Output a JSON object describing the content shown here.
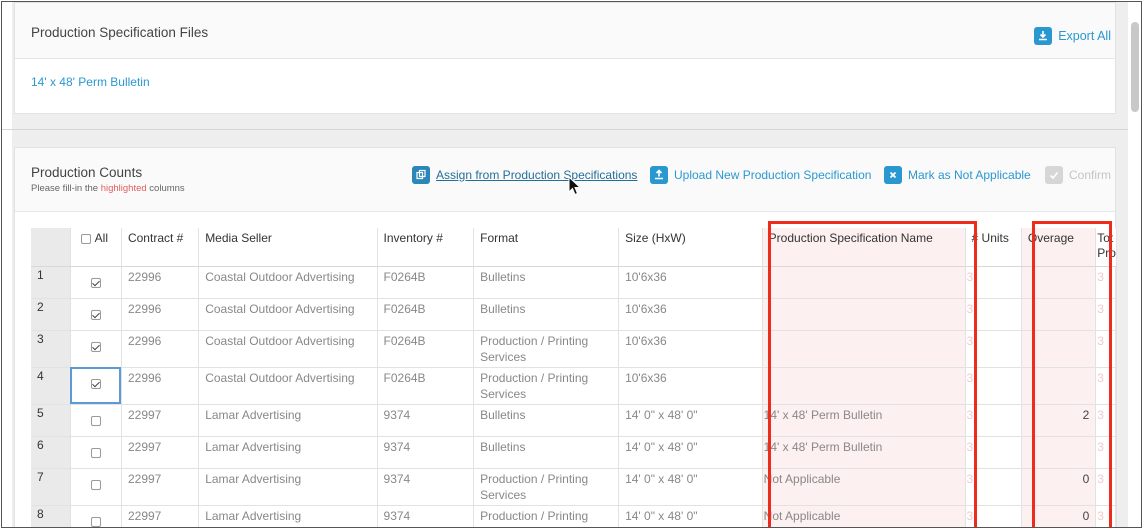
{
  "files_panel": {
    "title": "Production Specification Files",
    "export_label": "Export All",
    "spec_link": "14' x 48' Perm Bulletin"
  },
  "counts_panel": {
    "title": "Production Counts",
    "subtitle_before": "Please fill-in the ",
    "subtitle_highlight": "highlighted",
    "subtitle_after": " columns",
    "assign_label": "Assign from Production Specifications",
    "upload_label": "Upload New Production Specification",
    "mark_label": "Mark as Not Applicable",
    "confirm_label": "Confirm"
  },
  "table": {
    "headers": {
      "all": "All",
      "contract": "Contract #",
      "seller": "Media Seller",
      "inventory": "Inventory #",
      "format": "Format",
      "size": "Size (HxW)",
      "specname": "Production Specification Name",
      "units": "# Units",
      "overage": "Overage",
      "total": "Tot Pro"
    },
    "rows": [
      {
        "n": "1",
        "checked": true,
        "contract": "22996",
        "seller": "Coastal Outdoor Advertising",
        "inventory": "F0264B",
        "format": "Bulletins",
        "size": "10'6x36",
        "specname": "",
        "units": "3",
        "overage": "",
        "total": "3"
      },
      {
        "n": "2",
        "checked": true,
        "contract": "22996",
        "seller": "Coastal Outdoor Advertising",
        "inventory": "F0264B",
        "format": "Bulletins",
        "size": "10'6x36",
        "specname": "",
        "units": "3",
        "overage": "",
        "total": "3"
      },
      {
        "n": "3",
        "checked": true,
        "contract": "22996",
        "seller": "Coastal Outdoor Advertising",
        "inventory": "F0264B",
        "format": "Production / Printing Services",
        "size": "10'6x36",
        "specname": "",
        "units": "3",
        "overage": "",
        "total": "3"
      },
      {
        "n": "4",
        "checked": true,
        "contract": "22996",
        "seller": "Coastal Outdoor Advertising",
        "inventory": "F0264B",
        "format": "Production / Printing Services",
        "size": "10'6x36",
        "specname": "",
        "units": "3",
        "overage": "",
        "total": "3"
      },
      {
        "n": "5",
        "checked": false,
        "contract": "22997",
        "seller": "Lamar Advertising",
        "inventory": "9374",
        "format": "Bulletins",
        "size": "14' 0\" x 48' 0\"",
        "specname": "14' x 48' Perm Bulletin",
        "units": "3",
        "overage": "2",
        "total": "3"
      },
      {
        "n": "6",
        "checked": false,
        "contract": "22997",
        "seller": "Lamar Advertising",
        "inventory": "9374",
        "format": "Bulletins",
        "size": "14' 0\" x 48' 0\"",
        "specname": "14' x 48' Perm Bulletin",
        "units": "3",
        "overage": "",
        "total": "3"
      },
      {
        "n": "7",
        "checked": false,
        "contract": "22997",
        "seller": "Lamar Advertising",
        "inventory": "9374",
        "format": "Production / Printing Services",
        "size": "14' 0\" x 48' 0\"",
        "specname": "Not Applicable",
        "units": "3",
        "overage": "0",
        "total": "3"
      },
      {
        "n": "8",
        "checked": false,
        "contract": "22997",
        "seller": "Lamar Advertising",
        "inventory": "9374",
        "format": "Production / Printing Services",
        "size": "14' 0\" x 48' 0\"",
        "specname": "Not Applicable",
        "units": "3",
        "overage": "0",
        "total": "3"
      }
    ]
  },
  "colors": {
    "accent": "#2a98d0",
    "highlight_box": "#ee2c1c",
    "highlight_fill": "#fdf0f0"
  }
}
